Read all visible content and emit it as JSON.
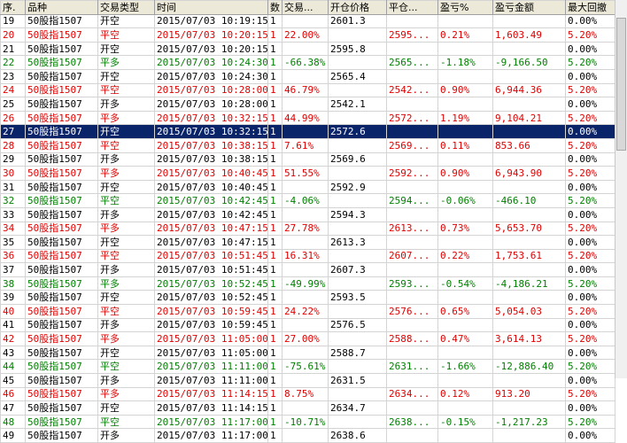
{
  "colors": {
    "red": "#e00000",
    "green": "#008000",
    "selected": "#0a246a"
  },
  "columns": [
    "序.",
    "品种",
    "交易类型",
    "时间",
    "数",
    "交易...",
    "开仓价格",
    "平仓...",
    "盈亏%",
    "盈亏金额",
    "最大回撤"
  ],
  "rows": [
    {
      "c": [
        "19",
        "50股指1507",
        "开空",
        "2015/07/03 10:19:15",
        "1",
        "",
        "2601.3",
        "",
        "",
        "",
        "0.00%"
      ],
      "t": "black"
    },
    {
      "c": [
        "20",
        "50股指1507",
        "平空",
        "2015/07/03 10:20:15",
        "1",
        "22.00%",
        "",
        "2595...",
        "0.21%",
        "1,603.49",
        "5.20%"
      ],
      "t": "red"
    },
    {
      "c": [
        "21",
        "50股指1507",
        "开空",
        "2015/07/03 10:20:15",
        "1",
        "",
        "2595.8",
        "",
        "",
        "",
        "0.00%"
      ],
      "t": "black"
    },
    {
      "c": [
        "22",
        "50股指1507",
        "平多",
        "2015/07/03 10:24:30",
        "1",
        "-66.38%",
        "",
        "2565...",
        "-1.18%",
        "-9,166.50",
        "5.20%"
      ],
      "t": "green"
    },
    {
      "c": [
        "23",
        "50股指1507",
        "开空",
        "2015/07/03 10:24:30",
        "1",
        "",
        "2565.4",
        "",
        "",
        "",
        "0.00%"
      ],
      "t": "black"
    },
    {
      "c": [
        "24",
        "50股指1507",
        "平空",
        "2015/07/03 10:28:00",
        "1",
        "46.79%",
        "",
        "2542...",
        "0.90%",
        "6,944.36",
        "5.20%"
      ],
      "t": "red"
    },
    {
      "c": [
        "25",
        "50股指1507",
        "开多",
        "2015/07/03 10:28:00",
        "1",
        "",
        "2542.1",
        "",
        "",
        "",
        "0.00%"
      ],
      "t": "black"
    },
    {
      "c": [
        "26",
        "50股指1507",
        "平多",
        "2015/07/03 10:32:15",
        "1",
        "44.99%",
        "",
        "2572...",
        "1.19%",
        "9,104.21",
        "5.20%"
      ],
      "t": "red"
    },
    {
      "c": [
        "27",
        "50股指1507",
        "开空",
        "2015/07/03 10:32:15",
        "1",
        "",
        "2572.6",
        "",
        "",
        "",
        "0.00%"
      ],
      "t": "selected"
    },
    {
      "c": [
        "28",
        "50股指1507",
        "平空",
        "2015/07/03 10:38:15",
        "1",
        "7.61%",
        "",
        "2569...",
        "0.11%",
        "853.66",
        "5.20%"
      ],
      "t": "red"
    },
    {
      "c": [
        "29",
        "50股指1507",
        "开多",
        "2015/07/03 10:38:15",
        "1",
        "",
        "2569.6",
        "",
        "",
        "",
        "0.00%"
      ],
      "t": "black"
    },
    {
      "c": [
        "30",
        "50股指1507",
        "平多",
        "2015/07/03 10:40:45",
        "1",
        "51.55%",
        "",
        "2592...",
        "0.90%",
        "6,943.90",
        "5.20%"
      ],
      "t": "red"
    },
    {
      "c": [
        "31",
        "50股指1507",
        "开空",
        "2015/07/03 10:40:45",
        "1",
        "",
        "2592.9",
        "",
        "",
        "",
        "0.00%"
      ],
      "t": "black"
    },
    {
      "c": [
        "32",
        "50股指1507",
        "平空",
        "2015/07/03 10:42:45",
        "1",
        "-4.06%",
        "",
        "2594...",
        "-0.06%",
        "-466.10",
        "5.20%"
      ],
      "t": "green"
    },
    {
      "c": [
        "33",
        "50股指1507",
        "开多",
        "2015/07/03 10:42:45",
        "1",
        "",
        "2594.3",
        "",
        "",
        "",
        "0.00%"
      ],
      "t": "black"
    },
    {
      "c": [
        "34",
        "50股指1507",
        "平多",
        "2015/07/03 10:47:15",
        "1",
        "27.78%",
        "",
        "2613...",
        "0.73%",
        "5,653.70",
        "5.20%"
      ],
      "t": "red"
    },
    {
      "c": [
        "35",
        "50股指1507",
        "开空",
        "2015/07/03 10:47:15",
        "1",
        "",
        "2613.3",
        "",
        "",
        "",
        "0.00%"
      ],
      "t": "black"
    },
    {
      "c": [
        "36",
        "50股指1507",
        "平空",
        "2015/07/03 10:51:45",
        "1",
        "16.31%",
        "",
        "2607...",
        "0.22%",
        "1,753.61",
        "5.20%"
      ],
      "t": "red"
    },
    {
      "c": [
        "37",
        "50股指1507",
        "开多",
        "2015/07/03 10:51:45",
        "1",
        "",
        "2607.3",
        "",
        "",
        "",
        "0.00%"
      ],
      "t": "black"
    },
    {
      "c": [
        "38",
        "50股指1507",
        "平多",
        "2015/07/03 10:52:45",
        "1",
        "-49.99%",
        "",
        "2593...",
        "-0.54%",
        "-4,186.21",
        "5.20%"
      ],
      "t": "green"
    },
    {
      "c": [
        "39",
        "50股指1507",
        "开空",
        "2015/07/03 10:52:45",
        "1",
        "",
        "2593.5",
        "",
        "",
        "",
        "0.00%"
      ],
      "t": "black"
    },
    {
      "c": [
        "40",
        "50股指1507",
        "平空",
        "2015/07/03 10:59:45",
        "1",
        "24.22%",
        "",
        "2576...",
        "0.65%",
        "5,054.03",
        "5.20%"
      ],
      "t": "red"
    },
    {
      "c": [
        "41",
        "50股指1507",
        "开多",
        "2015/07/03 10:59:45",
        "1",
        "",
        "2576.5",
        "",
        "",
        "",
        "0.00%"
      ],
      "t": "black"
    },
    {
      "c": [
        "42",
        "50股指1507",
        "平多",
        "2015/07/03 11:05:00",
        "1",
        "27.00%",
        "",
        "2588...",
        "0.47%",
        "3,614.13",
        "5.20%"
      ],
      "t": "red"
    },
    {
      "c": [
        "43",
        "50股指1507",
        "开空",
        "2015/07/03 11:05:00",
        "1",
        "",
        "2588.7",
        "",
        "",
        "",
        "0.00%"
      ],
      "t": "black"
    },
    {
      "c": [
        "44",
        "50股指1507",
        "平空",
        "2015/07/03 11:11:00",
        "1",
        "-75.61%",
        "",
        "2631...",
        "-1.66%",
        "-12,886.40",
        "5.20%"
      ],
      "t": "green"
    },
    {
      "c": [
        "45",
        "50股指1507",
        "开多",
        "2015/07/03 11:11:00",
        "1",
        "",
        "2631.5",
        "",
        "",
        "",
        "0.00%"
      ],
      "t": "black"
    },
    {
      "c": [
        "46",
        "50股指1507",
        "平多",
        "2015/07/03 11:14:15",
        "1",
        "8.75%",
        "",
        "2634...",
        "0.12%",
        "913.20",
        "5.20%"
      ],
      "t": "red"
    },
    {
      "c": [
        "47",
        "50股指1507",
        "开空",
        "2015/07/03 11:14:15",
        "1",
        "",
        "2634.7",
        "",
        "",
        "",
        "0.00%"
      ],
      "t": "black"
    },
    {
      "c": [
        "48",
        "50股指1507",
        "平空",
        "2015/07/03 11:17:00",
        "1",
        "-10.71%",
        "",
        "2638...",
        "-0.15%",
        "-1,217.23",
        "5.20%"
      ],
      "t": "green"
    },
    {
      "c": [
        "49",
        "50股指1507",
        "开多",
        "2015/07/03 11:17:00",
        "1",
        "",
        "2638.6",
        "",
        "",
        "",
        "0.00%"
      ],
      "t": "black"
    }
  ]
}
